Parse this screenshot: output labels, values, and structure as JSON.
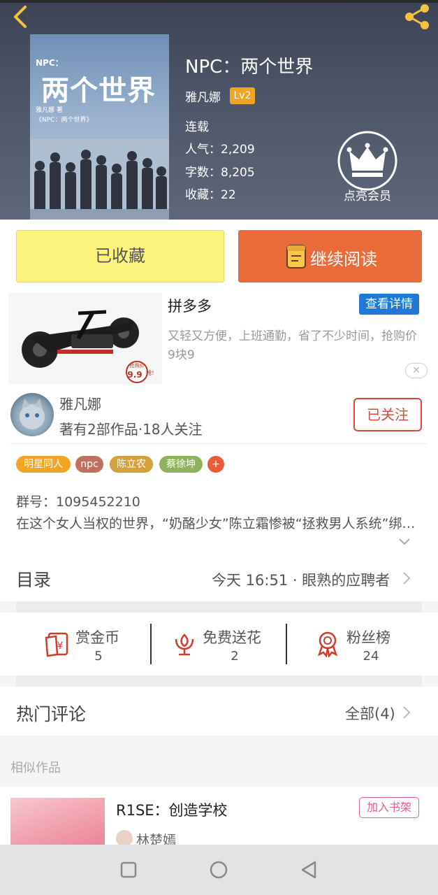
{
  "header": {
    "back_icon": "chevron-left-icon",
    "share_icon": "share-icon"
  },
  "book": {
    "cover": {
      "npc_label": "NPC：",
      "title": "两个世界",
      "author_line": "雅凡娜 著",
      "subtitle_line": "《NPC：两个世界》"
    },
    "title": "NPC：两个世界",
    "author": "雅凡娜",
    "level": "Lv2",
    "status": "连载",
    "popularity": "人气：2,209",
    "word_count": "字数：8,205",
    "favorites": "收藏：22",
    "vip_label": "点亮会员"
  },
  "actions": {
    "collect_label": "已收藏",
    "read_label": "继续阅读"
  },
  "ad": {
    "title": "拼多多",
    "detail_label": "查看详情",
    "description": "又轻又方便，上班通勤，省了不少时间，抢购价9块9",
    "price_badge_top": "抢购价",
    "price_badge_value": "9.9",
    "price_badge_suffix": "抢!",
    "close_label": "✕"
  },
  "author_card": {
    "name": "雅凡娜",
    "stats": "著有2部作品·18人关注",
    "follow_label": "已关注"
  },
  "tags": [
    {
      "label": "明星同人",
      "color": "#f0a524"
    },
    {
      "label": "npc",
      "color": "#c0705e"
    },
    {
      "label": "陈立农",
      "color": "#d4a23a"
    },
    {
      "label": "蔡徐坤",
      "color": "#8fb35d"
    },
    {
      "label": "+",
      "color": "#e85c3a"
    }
  ],
  "intro": {
    "group_number": "群号：1095452210",
    "text": "在这个女人当权的世界，“奶酪少女”陈立霜惨被“拯救男人系统”绑定……"
  },
  "toc": {
    "title": "目录",
    "latest": "今天 16:51 · 眼熟的应聘者"
  },
  "rewards": [
    {
      "label": "赏金币",
      "value": "5",
      "icon": "red-envelope-icon"
    },
    {
      "label": "免费送花",
      "value": "2",
      "icon": "flower-icon"
    },
    {
      "label": "粉丝榜",
      "value": "24",
      "icon": "medal-icon"
    }
  ],
  "comments": {
    "title": "热门评论",
    "all_label": "全部(4)"
  },
  "similar": {
    "section_label": "相似作品",
    "items": [
      {
        "title": "R1SE：创造学校",
        "author": "林楚嫣",
        "add_label": "加入书架"
      }
    ]
  },
  "colors": {
    "accent_orange": "#ea6b3a",
    "collect_yellow": "#fbf37c",
    "level_badge": "#f0a524",
    "detail_blue": "#1f79d9",
    "follow_red": "#d64a3c",
    "icon_red": "#d23a2a",
    "add_pink": "#e0609a"
  },
  "system_nav": {
    "recent_icon": "square-icon",
    "home_icon": "circle-icon",
    "back_icon": "triangle-back-icon"
  }
}
